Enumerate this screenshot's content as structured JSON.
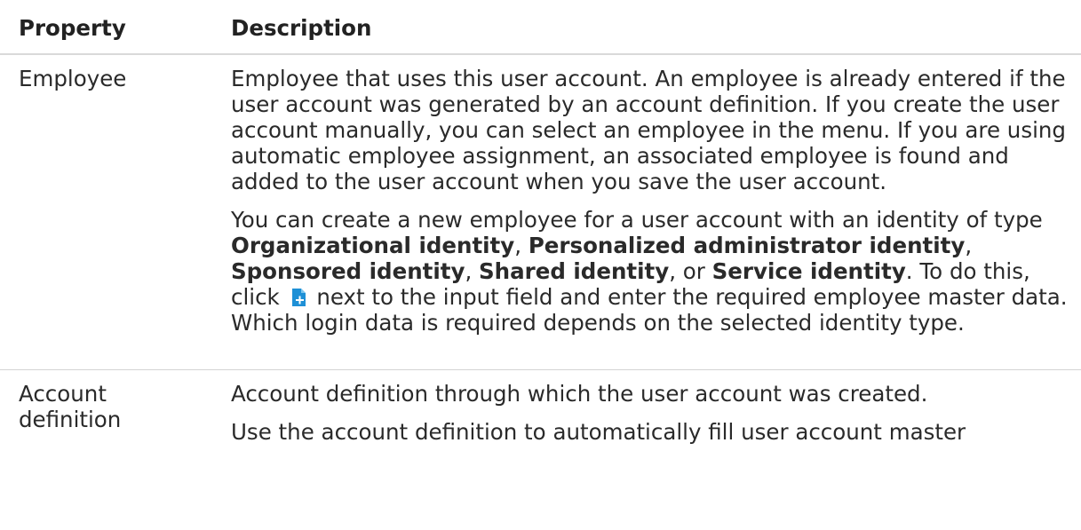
{
  "table": {
    "headers": {
      "property": "Property",
      "description": "Description"
    },
    "rows": [
      {
        "property": "Employee",
        "para1": "Employee that uses this user account. An employee is already entered if the user account was generated by an account definition. If you create the user account manually, you can select an employee in the menu. If you are using automatic employee assignment, an associated employee is found and added to the user account when you save the user account.",
        "para2": {
          "t1": "You can create a new employee for a user account with an identity of type ",
          "b1": "Organizational identity",
          "t2": ", ",
          "b2": "Personalized administrator identity",
          "t3": ", ",
          "b3": "Sponsored identity",
          "t4": ", ",
          "b4": "Shared identity",
          "t5": ", or ",
          "b5": "Service identity",
          "t6": ". To do this, click ",
          "t7": " next to the input field and enter the required employee master data. Which login data is required depends on the selected identity type."
        }
      },
      {
        "property": "Account definition",
        "para1": "Account definition through which the user account was created.",
        "para2": "Use the account definition to automatically fill user account master"
      }
    ]
  },
  "icons": {
    "create_employee": "add-new-icon"
  },
  "colors": {
    "icon_blue": "#1e90d6",
    "icon_light": "#7cc6ee"
  }
}
